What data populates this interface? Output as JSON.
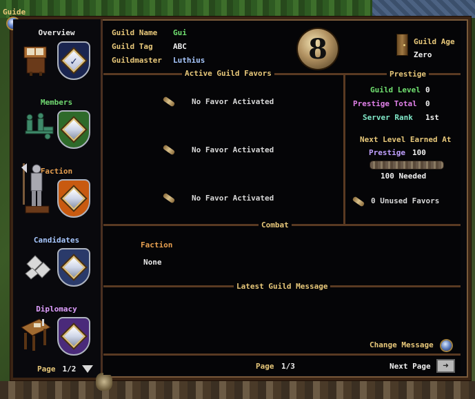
{
  "window": {
    "title": "Guide"
  },
  "sidebar": {
    "items": [
      {
        "label": "Overview",
        "color": "#e8e8e8",
        "shield_color": "#1a2550"
      },
      {
        "label": "Members",
        "color": "#70d870",
        "shield_color": "#2e6a2a"
      },
      {
        "label": "Faction",
        "color": "#e8a050",
        "shield_color": "#c85a10"
      },
      {
        "label": "Candidates",
        "color": "#a8c8ff",
        "shield_color": "#2a3a6a"
      },
      {
        "label": "Diplomacy",
        "color": "#e0a0ff",
        "shield_color": "#4a2a7a"
      }
    ],
    "page": {
      "label": "Page",
      "value": "1/2"
    }
  },
  "header": {
    "guild_name": {
      "label": "Guild Name",
      "value": "Gui",
      "color": "#70e070"
    },
    "guild_tag": {
      "label": "Guild Tag",
      "value": "ABC"
    },
    "guildmaster": {
      "label": "Guildmaster",
      "value": "Luthius",
      "color": "#a8c8ff"
    },
    "guild_age": {
      "label": "Guild Age",
      "value": "Zero"
    }
  },
  "favors": {
    "title": "Active Guild Favors",
    "slots": [
      "No Favor Activated",
      "No Favor Activated",
      "No Favor Activated"
    ]
  },
  "prestige": {
    "title": "Prestige",
    "guild_level": {
      "label": "Guild Level",
      "value": "0"
    },
    "prestige_total": {
      "label": "Prestige Total",
      "value": "0"
    },
    "server_rank": {
      "label": "Server Rank",
      "value": "1st"
    },
    "next_level_title": "Next Level Earned At",
    "next_prestige": {
      "label": "Prestige",
      "value": "100"
    },
    "needed": "100 Needed",
    "progress_fraction": 0,
    "unused_favors": "0 Unused Favors"
  },
  "combat": {
    "title": "Combat",
    "faction_label": "Faction",
    "faction_value": "None"
  },
  "message": {
    "title": "Latest Guild Message",
    "change_label": "Change Message"
  },
  "footer": {
    "page_label": "Page",
    "page_value": "1/3",
    "next_label": "Next Page"
  }
}
